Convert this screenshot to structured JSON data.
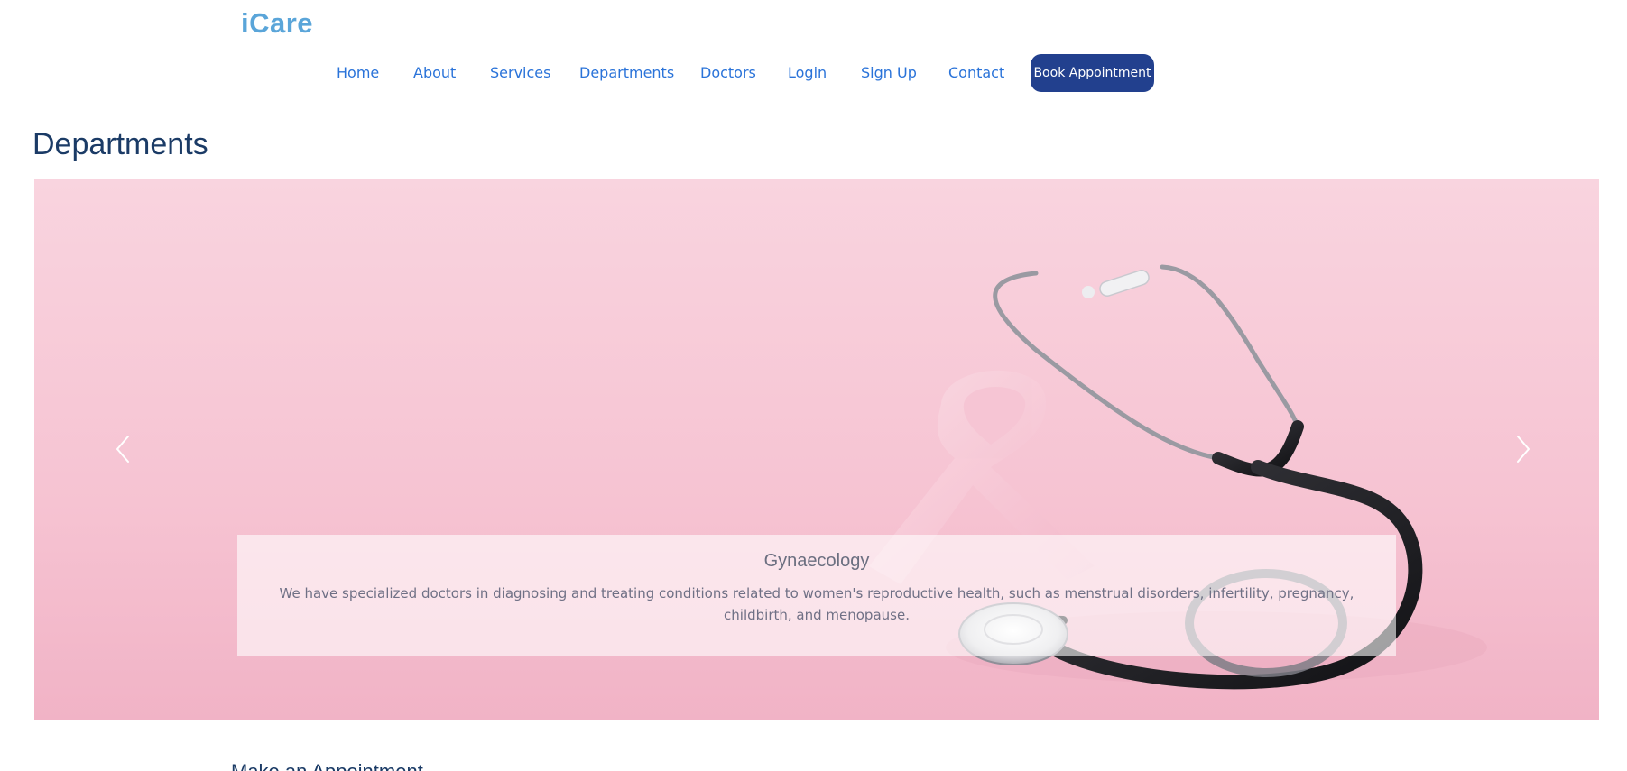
{
  "brand": {
    "logo": "iCare",
    "color": "#5aa5d9"
  },
  "nav": {
    "links": [
      {
        "label": "Home"
      },
      {
        "label": "About"
      },
      {
        "label": "Services"
      },
      {
        "label": "Departments"
      },
      {
        "label": "Doctors"
      },
      {
        "label": "Login"
      },
      {
        "label": "Sign Up"
      },
      {
        "label": "Contact"
      }
    ],
    "cta_label": "Book Appointment",
    "link_color": "#2a73d9",
    "cta_color": "#22408e"
  },
  "departments": {
    "title": "Departments",
    "carousel": {
      "prev_icon": "chevron-left-icon",
      "next_icon": "chevron-right-icon",
      "image": "pink-ribbon-stethoscope",
      "slide": {
        "title": "Gynaecology",
        "text": "We have specialized doctors in diagnosing and treating conditions related to women's reproductive health, such as menstrual disorders, infertility, pregnancy, childbirth, and menopause."
      }
    }
  },
  "appointment": {
    "heading": "Make an Appointment"
  }
}
